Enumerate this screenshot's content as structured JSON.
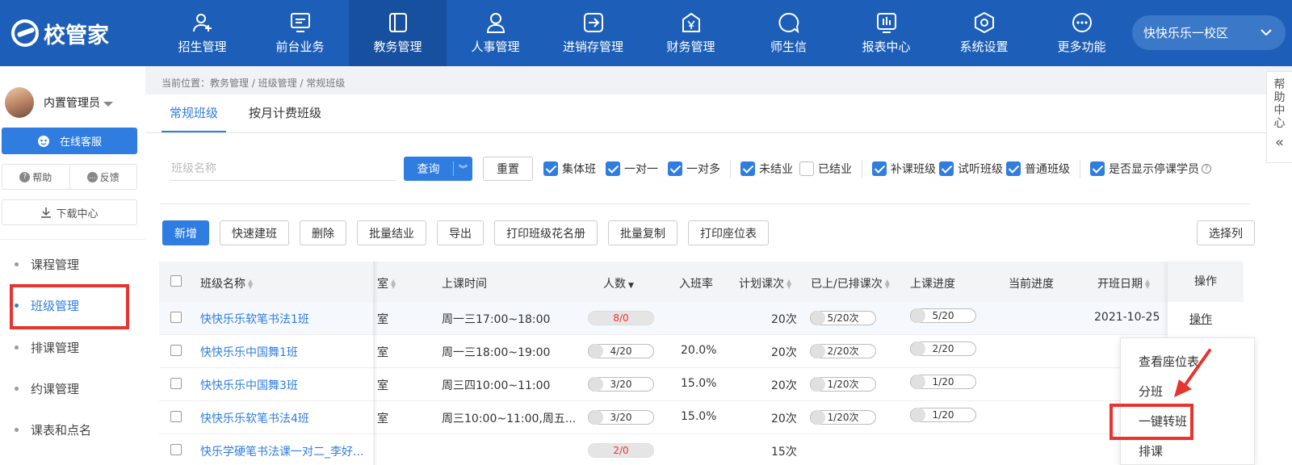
{
  "app": {
    "logo_text": "校管家"
  },
  "nav": [
    {
      "label": "招生管理",
      "icon": "person-add-icon"
    },
    {
      "label": "前台业务",
      "icon": "monitor-icon"
    },
    {
      "label": "教务管理",
      "icon": "book-icon"
    },
    {
      "label": "人事管理",
      "icon": "person-icon"
    },
    {
      "label": "进销存管理",
      "icon": "box-arrow-icon"
    },
    {
      "label": "财务管理",
      "icon": "money-icon"
    },
    {
      "label": "师生信",
      "icon": "chat-icon"
    },
    {
      "label": "报表中心",
      "icon": "chart-icon"
    },
    {
      "label": "系统设置",
      "icon": "settings-icon"
    },
    {
      "label": "更多功能",
      "icon": "more-icon"
    }
  ],
  "campus": "快快乐乐一校区",
  "sidebar": {
    "user_name": "内置管理员",
    "service": "在线客服",
    "help": "帮助",
    "feedback": "反馈",
    "download": "下载中心",
    "items": [
      "课程管理",
      "班级管理",
      "排课管理",
      "约课管理",
      "课表和点名"
    ]
  },
  "breadcrumb": "当前位置：教务管理 / 班级管理 / 常规班级",
  "tabs": [
    "常规班级",
    "按月计费班级"
  ],
  "filter": {
    "placeholder": "班级名称",
    "query": "查询",
    "reset": "重置",
    "checks": [
      {
        "label": "集体班",
        "checked": true
      },
      {
        "label": "一对一",
        "checked": true
      },
      {
        "label": "一对多",
        "checked": true
      },
      {
        "label": "未结业",
        "checked": true
      },
      {
        "label": "已结业",
        "checked": false
      },
      {
        "label": "补课班级",
        "checked": true
      },
      {
        "label": "试听班级",
        "checked": true
      },
      {
        "label": "普通班级",
        "checked": true
      },
      {
        "label": "是否显示停课学员",
        "checked": true
      }
    ]
  },
  "toolbar": [
    "新增",
    "快速建班",
    "删除",
    "批量结业",
    "导出",
    "打印班级花名册",
    "批量复制",
    "打印座位表"
  ],
  "select_columns": "选择列",
  "table": {
    "headers": {
      "name": "班级名称",
      "room": "室",
      "time": "上课时间",
      "count": "人数",
      "rate": "入班率",
      "planned": "计划课次",
      "scheduled": "已上/已排课次",
      "progress": "上课进度",
      "current": "当前进度",
      "start": "开班日期",
      "op": "操作"
    },
    "rows": [
      {
        "name": "快快乐乐软笔书法1班",
        "room": "室",
        "time": "周一三17:00~18:00",
        "count": "8/0",
        "count_red": true,
        "rate": "",
        "planned": "20次",
        "scheduled": "5/20次",
        "progress": "5/20",
        "start": "2021-10-25",
        "op": "操作"
      },
      {
        "name": "快快乐乐中国舞1班",
        "room": "室",
        "time": "周一三18:00~19:00",
        "count": "4/20",
        "count_red": false,
        "rate": "20.0%",
        "planned": "20次",
        "scheduled": "2/20次",
        "progress": "2/20",
        "start": "",
        "op": ""
      },
      {
        "name": "快快乐乐中国舞3班",
        "room": "室",
        "time": "周三四10:00~11:00",
        "count": "3/20",
        "count_red": false,
        "rate": "15.0%",
        "planned": "20次",
        "scheduled": "1/20次",
        "progress": "1/20",
        "start": "",
        "op": ""
      },
      {
        "name": "快快乐乐软笔书法4班",
        "room": "室",
        "time": "周三10:00~11:00,周五...",
        "count": "3/20",
        "count_red": false,
        "rate": "15.0%",
        "planned": "20次",
        "scheduled": "1/20次",
        "progress": "1/20",
        "start": "",
        "op": ""
      },
      {
        "name": "快乐学硬笔书法课一对二_李好...",
        "room": "",
        "time": "",
        "count": "2/0",
        "count_red": true,
        "rate": "",
        "planned": "15次",
        "scheduled": "",
        "progress": "",
        "start": "",
        "op": ""
      }
    ]
  },
  "op_menu": [
    "查看座位表",
    "分班",
    "一键转班",
    "排课"
  ],
  "help_center": [
    "帮",
    "助",
    "中",
    "心"
  ],
  "colors": {
    "primary": "#2f7de1",
    "nav": "#1d5fb8",
    "highlight": "#e8332f"
  }
}
